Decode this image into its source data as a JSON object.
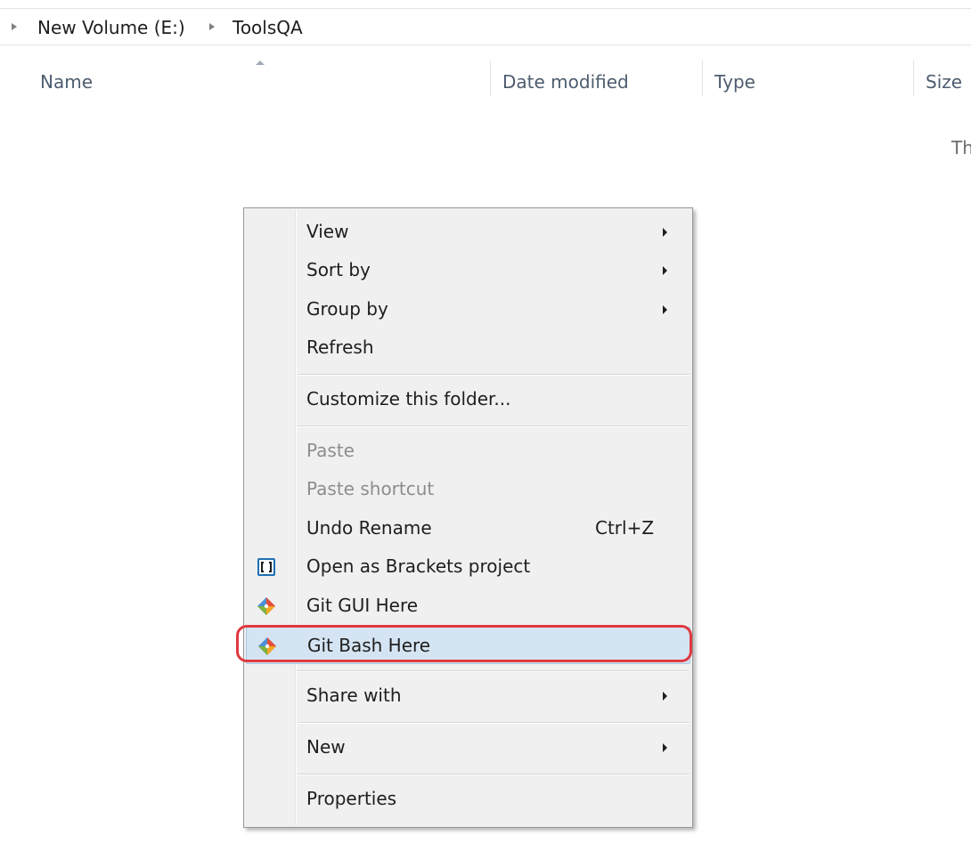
{
  "breadcrumb": {
    "items": [
      {
        "label": "New Volume (E:)"
      },
      {
        "label": "ToolsQA"
      }
    ]
  },
  "columns": {
    "name": "Name",
    "date_modified": "Date modified",
    "type": "Type",
    "size": "Size"
  },
  "empty_message": "Th",
  "context_menu": {
    "view": {
      "label": "View",
      "submenu": true
    },
    "sort_by": {
      "label": "Sort by",
      "submenu": true
    },
    "group_by": {
      "label": "Group by",
      "submenu": true
    },
    "refresh": {
      "label": "Refresh"
    },
    "customize": {
      "label": "Customize this folder..."
    },
    "paste": {
      "label": "Paste",
      "disabled": true
    },
    "paste_shortcut": {
      "label": "Paste shortcut",
      "disabled": true
    },
    "undo_rename": {
      "label": "Undo Rename",
      "shortcut": "Ctrl+Z"
    },
    "open_brackets": {
      "label": "Open as Brackets project",
      "icon": "brackets-icon"
    },
    "git_gui": {
      "label": "Git GUI Here",
      "icon": "git-icon"
    },
    "git_bash": {
      "label": "Git Bash Here",
      "icon": "git-icon",
      "highlighted": true
    },
    "share_with": {
      "label": "Share with",
      "submenu": true
    },
    "new": {
      "label": "New",
      "submenu": true
    },
    "properties": {
      "label": "Properties"
    }
  },
  "colors": {
    "highlight_bg": "#d5e4f2",
    "annotation_outline": "#e0393f",
    "menu_bg": "#f0f0f0"
  }
}
